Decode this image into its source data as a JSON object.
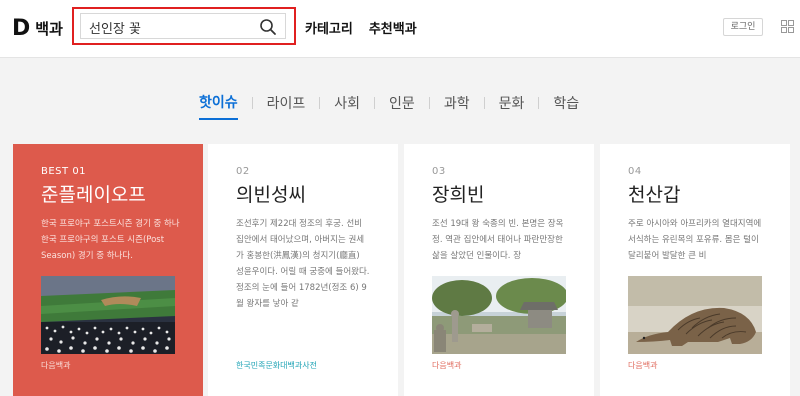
{
  "header": {
    "logo_letter": "D",
    "logo_text": "백과",
    "search": {
      "value": "선인장 꽃",
      "placeholder": ""
    },
    "nav": [
      "카테고리",
      "추천백과"
    ],
    "login_label": "로그인"
  },
  "tabs": [
    {
      "label": "핫이슈",
      "active": true
    },
    {
      "label": "라이프",
      "active": false
    },
    {
      "label": "사회",
      "active": false
    },
    {
      "label": "인문",
      "active": false
    },
    {
      "label": "과학",
      "active": false
    },
    {
      "label": "문화",
      "active": false
    },
    {
      "label": "학습",
      "active": false
    }
  ],
  "cards": [
    {
      "num": "BEST 01",
      "title": "준플레이오프",
      "desc": "한국 프로야구 포스트시즌 경기 중 하나 한국 프로야구의 포스트 시즌(Post Season) 경기 중 하나다.",
      "source": "다음백과",
      "image": "baseball-stadium"
    },
    {
      "num": "02",
      "title": "의빈성씨",
      "desc": "조선후기 제22대 정조의 후궁. 선비 집안에서 태어났으며, 아버지는 권세가 홍봉한(洪鳳漢)의 청지기(廳直) 성윤우이다. 어릴 때 궁중에 들어왔다. 정조의 눈에 들어 1782년(정조 6) 9월 왕자를 낳아 같",
      "source": "한국민족문화대백과사전",
      "image": ""
    },
    {
      "num": "03",
      "title": "장희빈",
      "desc": "조선 19대 왕 숙종의 빈. 본명은 장옥정. 역관 집안에서 태어나 파란만장한 삶을 살았던 인물이다. 장",
      "source": "다음백과",
      "image": "royal-tomb"
    },
    {
      "num": "04",
      "title": "천산갑",
      "desc": "주로 아시아와 아프리카의 열대지역에 서식하는 유린목의 포유류. 몸은 털이 달리붙어 발달한 큰 비",
      "source": "다음백과",
      "image": "pangolin"
    }
  ]
}
